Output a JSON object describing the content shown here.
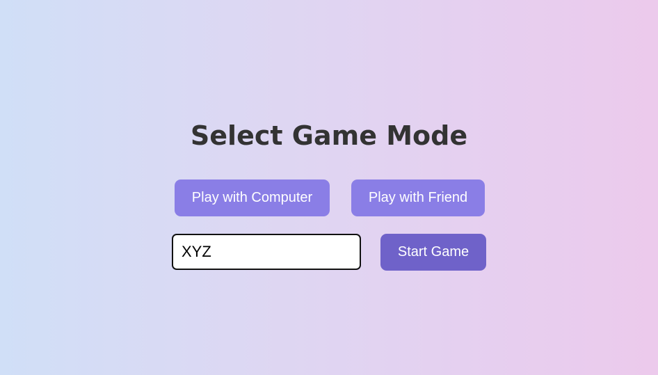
{
  "page": {
    "title": "Select Game Mode"
  },
  "modes": {
    "computer_label": "Play with Computer",
    "friend_label": "Play with Friend"
  },
  "player": {
    "name_value": "XYZ",
    "name_placeholder": ""
  },
  "actions": {
    "start_label": "Start Game"
  },
  "colors": {
    "background_left": "#d0dff7",
    "background_right": "#eccaec",
    "mode_button": "#8a7ee6",
    "start_button": "#6f62c9",
    "title_text": "#333333"
  }
}
